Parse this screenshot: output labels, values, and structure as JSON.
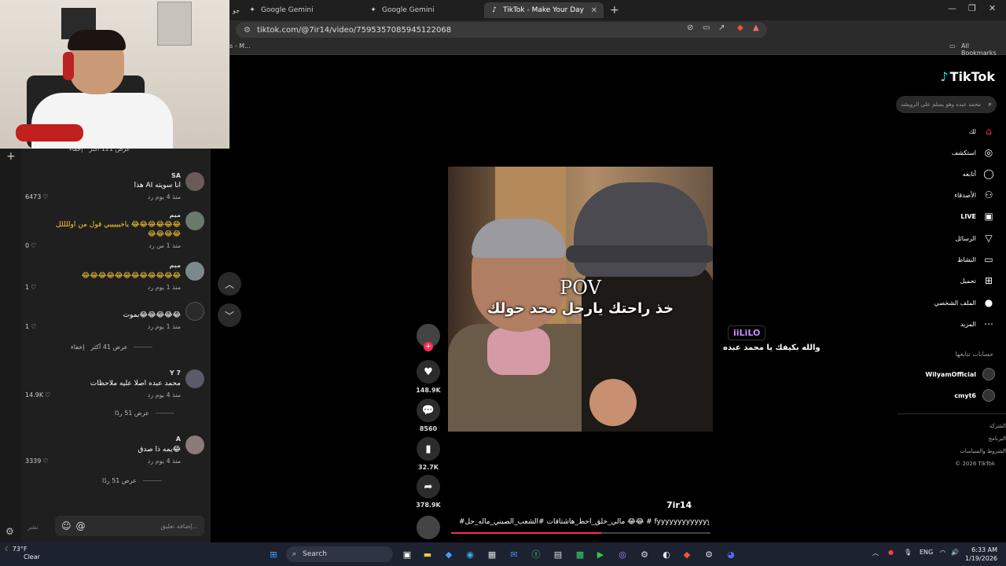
{
  "browser": {
    "tabs": [
      {
        "label": "Google Gemini",
        "active": false
      },
      {
        "label": "Google Gemini",
        "active": false
      },
      {
        "label": "TikTok - Make Your Day",
        "active": true
      }
    ],
    "url": "tiktok.com/@7ir14/video/7595357085945122068",
    "bookmark_left": "s - M...",
    "all_bookmarks": "All Bookmarks"
  },
  "comments": {
    "top_show_more": "عرض 121 أكثر",
    "top_hide": "إخفاء",
    "items": [
      {
        "name": "SA",
        "text": "هذا AI انا سويته",
        "meta": "منذ 4 يوم    رد",
        "likes": "6473"
      },
      {
        "name": "ميم",
        "text": "ياخيييييي قول من اوللللل 😂😂😂😂😂😂",
        "text2": "😂😂😂😂",
        "meta": "منذ 1 س    رد",
        "likes": "0"
      },
      {
        "name": "ميم",
        "text": "😂😂😂😂😂😂😂😂😂😂😂😂",
        "meta": "منذ 1 يوم    رد",
        "likes": "1"
      },
      {
        "name": "",
        "text": "بموت😂😂😂😂😂",
        "meta": "منذ 1 يوم    رد",
        "likes": "1"
      },
      {
        "name": "Y 7",
        "text": "محمد عبده اصلا عليه ملاحظات",
        "meta": "منذ 4 يوم    رد",
        "likes": "14.9K"
      },
      {
        "name": "A",
        "text": "يمه ذا صدق😂",
        "meta": "منذ 4 يوم    رد",
        "likes": "3339"
      }
    ],
    "show_more_41": "عرض 41 أكثر",
    "hide": "إخفاء",
    "replies_51": "عرض 51 ردًا",
    "replies_51b": "عرض 51 ردًا",
    "input_placeholder": "إضافة تعليق...",
    "post_label": "نشر"
  },
  "video": {
    "pov": "POV",
    "caption": "خذ راحتك يارجل محد حولك",
    "author": "7ir14",
    "description": "#مالي_خلق_احط_هاشتاقات #الشعب_الصيني_ماله_حل 😂😂 # fyyyyyyyyyyyyyyyy",
    "likes": "148.9K",
    "comments": "8560",
    "saves": "32.7K",
    "shares": "378.9K",
    "progress": 0.58,
    "live_user": "iiLiLO",
    "live_text": "والله بكيفك يا محمد عبده"
  },
  "sidebar": {
    "logo": "TikTok",
    "search_placeholder": "محمد عبده وهو يسلم على الرويشد",
    "nav": [
      {
        "label": "لك",
        "icon": "home-icon"
      },
      {
        "label": "استكشف",
        "icon": "compass-icon"
      },
      {
        "label": "أتابعه",
        "icon": "following-icon"
      },
      {
        "label": "الأصدقاء",
        "icon": "friends-icon"
      },
      {
        "label": "LIVE",
        "icon": "live-icon"
      },
      {
        "label": "الرسائل",
        "icon": "messages-icon"
      },
      {
        "label": "النشاط",
        "icon": "activity-icon"
      },
      {
        "label": "تحميل",
        "icon": "upload-icon"
      },
      {
        "label": "الملف الشخصي",
        "icon": "profile-icon"
      },
      {
        "label": "المزيد",
        "icon": "more-icon"
      }
    ],
    "following_title": "حسابات تتابعها",
    "following": [
      "WilyamOfficial",
      "cmyt6"
    ],
    "footer": [
      "الشركة",
      "البرنامج",
      "الشروط والسياسات",
      "© 2026 TikTok"
    ]
  },
  "taskbar": {
    "temp": "73°F",
    "weather": "Clear",
    "search": "Search",
    "lang": "ENG",
    "time": "6:33 AM",
    "date": "1/19/2026"
  },
  "colors": {
    "accent": "#fe2c55",
    "cyan": "#25f4ee",
    "live_purple": "#c78bff"
  }
}
